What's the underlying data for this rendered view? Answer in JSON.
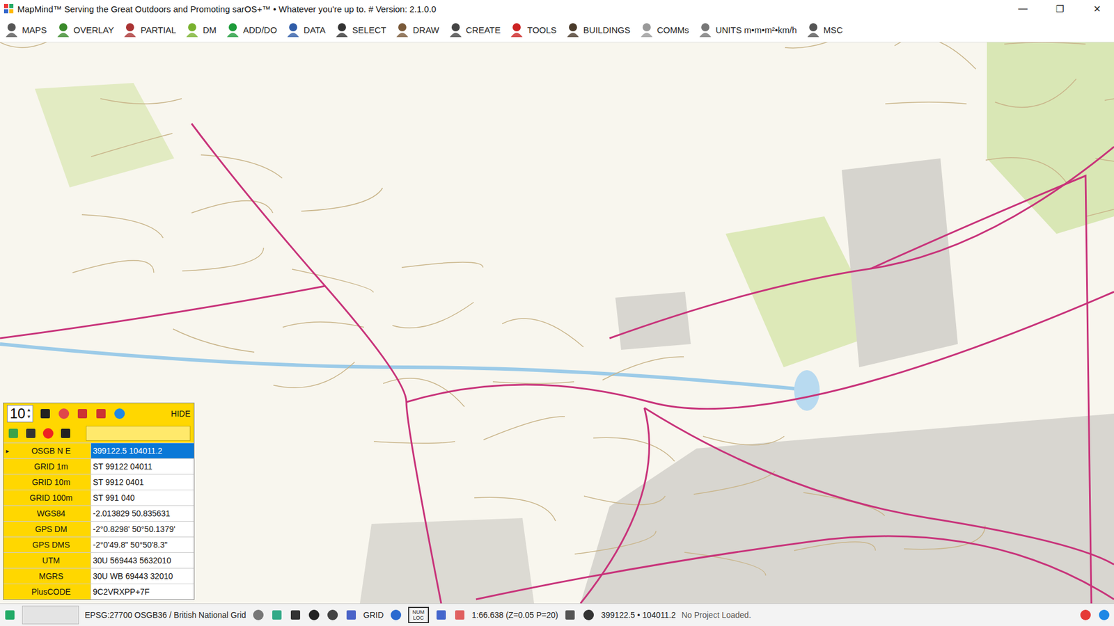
{
  "window": {
    "title": "MapMind™ Serving the Great Outdoors and Promoting sarOS+™ • Whatever you're up to. #  Version: 2.1.0.0",
    "controls": [
      "—",
      "❐",
      "✕"
    ]
  },
  "toolbar": [
    {
      "label": "MAPS"
    },
    {
      "label": "OVERLAY"
    },
    {
      "label": "PARTIAL"
    },
    {
      "label": "DM"
    },
    {
      "label": "ADD/DO"
    },
    {
      "label": "DATA"
    },
    {
      "label": "SELECT"
    },
    {
      "label": "DRAW"
    },
    {
      "label": "CREATE"
    },
    {
      "label": "TOOLS"
    },
    {
      "label": "BUILDINGS"
    },
    {
      "label": "COMMs"
    },
    {
      "label": "UNITS m•m•m²•km/h"
    },
    {
      "label": "MSC"
    }
  ],
  "panel": {
    "zoom": "10",
    "up": "▲",
    "down": "▼",
    "hide": "HIDE",
    "input": "",
    "marker": "▸",
    "rows": [
      {
        "label": "OSGB N E",
        "value": "399122.5 104011.2",
        "selected": true
      },
      {
        "label": "GRID 1m",
        "value": "ST 99122 04011",
        "selected": false
      },
      {
        "label": "GRID 10m",
        "value": "ST 9912 0401",
        "selected": false
      },
      {
        "label": "GRID 100m",
        "value": "ST 991 040",
        "selected": false
      },
      {
        "label": "WGS84",
        "value": "-2.013829 50.835631",
        "selected": false
      },
      {
        "label": "GPS DM",
        "value": "-2°0.8298' 50°50.1379'",
        "selected": false
      },
      {
        "label": "GPS DMS",
        "value": "-2°0'49.8\" 50°50'8.3\"",
        "selected": false
      },
      {
        "label": "UTM",
        "value": "30U 569443 5632010",
        "selected": false
      },
      {
        "label": "MGRS",
        "value": "30U WB 69443 32010",
        "selected": false
      },
      {
        "label": "PlusCODE",
        "value": "9C2VRXPP+7F",
        "selected": false
      }
    ]
  },
  "status_bar": {
    "crs": "EPSG:27700 OSGB36 / British National Grid",
    "grid": "GRID",
    "numloc": "NUM LOC",
    "scale": "1:66.638 (Z=0.05 P=20)",
    "coords": "399122.5 • 104011.2",
    "project": "No Project Loaded."
  }
}
